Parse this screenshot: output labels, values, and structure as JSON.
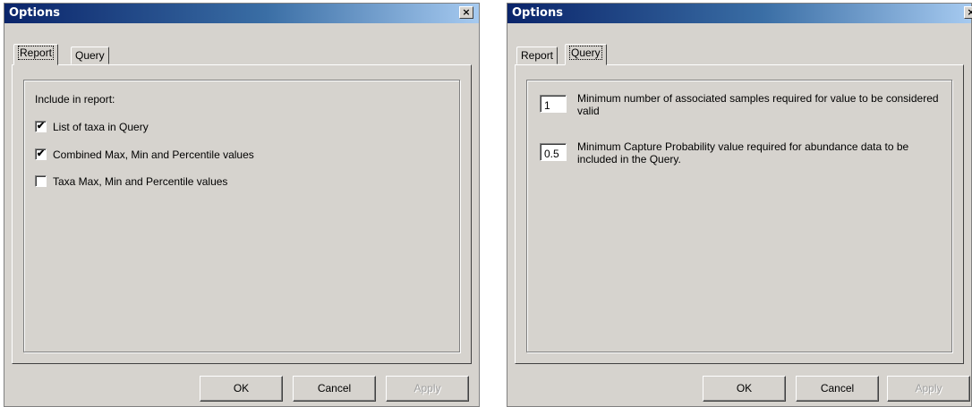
{
  "left_dialog": {
    "title": "Options",
    "close_glyph": "×",
    "tabs": [
      {
        "label": "Report",
        "active": true
      },
      {
        "label": "Query",
        "active": false
      }
    ],
    "include_label": "Include in report:",
    "checkboxes": [
      {
        "label": "List of taxa in Query",
        "checked": true,
        "mark": "✔"
      },
      {
        "label": "Combined Max, Min and Percentile values",
        "checked": true,
        "mark": "✔"
      },
      {
        "label": "Taxa Max, Min and Percentile values",
        "checked": false,
        "mark": ""
      }
    ],
    "buttons": {
      "ok": "OK",
      "cancel": "Cancel",
      "apply": "Apply"
    }
  },
  "right_dialog": {
    "title": "Options",
    "close_glyph": "×",
    "tabs": [
      {
        "label": "Report",
        "active": false
      },
      {
        "label": "Query",
        "active": true
      }
    ],
    "fields": [
      {
        "value": "1",
        "description": "Minimum number of associated samples required for value to be considered valid"
      },
      {
        "value": "0.5",
        "description": "Minimum Capture Probability value required for abundance data to be included in the Query."
      }
    ],
    "buttons": {
      "ok": "OK",
      "cancel": "Cancel",
      "apply": "Apply"
    }
  }
}
